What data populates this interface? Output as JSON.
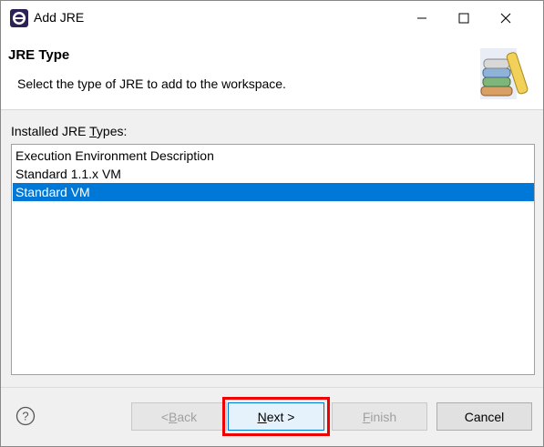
{
  "window": {
    "title": "Add JRE",
    "controls": {
      "minimize_icon": "minimize-icon",
      "maximize_icon": "maximize-icon",
      "close_icon": "close-icon"
    }
  },
  "banner": {
    "title": "JRE Type",
    "description": "Select the type of JRE to add to the workspace.",
    "image_icon": "library-books-icon"
  },
  "jre_types": {
    "label_prefix": "Installed JRE ",
    "label_underlined": "T",
    "label_suffix": "ypes:",
    "items": [
      {
        "label": "Execution Environment Description",
        "selected": false
      },
      {
        "label": "Standard 1.1.x VM",
        "selected": false
      },
      {
        "label": "Standard VM",
        "selected": true
      }
    ]
  },
  "buttons": {
    "back_prefix": "< ",
    "back_underlined": "B",
    "back_suffix": "ack",
    "next_underlined": "N",
    "next_suffix": "ext >",
    "finish_underlined": "F",
    "finish_suffix": "inish",
    "cancel": "Cancel"
  },
  "colors": {
    "selection": "#0078d7",
    "highlight_box": "#e00000"
  }
}
